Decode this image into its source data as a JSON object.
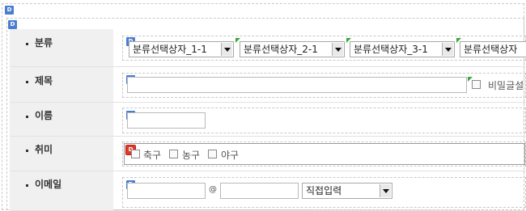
{
  "form": {
    "rows": [
      {
        "label": "분류"
      },
      {
        "label": "제목"
      },
      {
        "label": "이름"
      },
      {
        "label": "취미"
      },
      {
        "label": "이메일"
      }
    ],
    "category_selects": [
      "분류선택상자_1-1",
      "분류선택상자_2-1",
      "분류선택상자_3-1",
      "분류선택상자"
    ],
    "secret_label": "비밀글설",
    "hobbies": [
      "축구",
      "농구",
      "야구"
    ],
    "email_at": "@",
    "email_domain_select": "직접입력",
    "design_marker": "D"
  }
}
